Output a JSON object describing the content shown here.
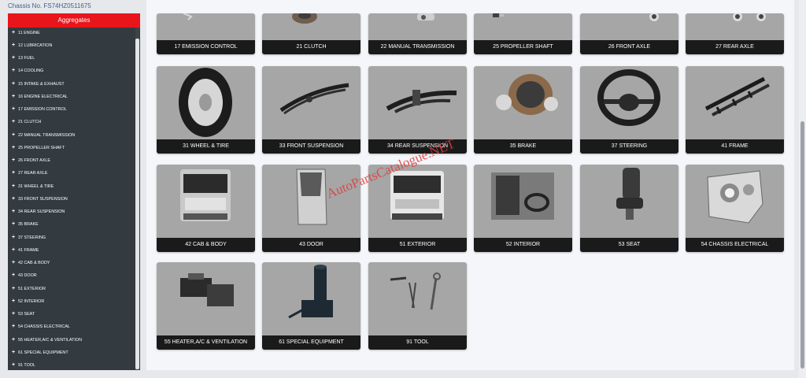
{
  "chassis": "Chassis No.  FS74HZ0511675",
  "sidebar": {
    "title": "Aggregates",
    "items": [
      {
        "label": "11 ENGINE"
      },
      {
        "label": "12 LUBRICATION"
      },
      {
        "label": "13 FUEL"
      },
      {
        "label": "14 COOLING"
      },
      {
        "label": "15 INTAKE & EXHAUST"
      },
      {
        "label": "16 ENGINE ELECTRICAL"
      },
      {
        "label": "17 EMISSION CONTROL"
      },
      {
        "label": "21 CLUTCH"
      },
      {
        "label": "22 MANUAL TRANSMISSION"
      },
      {
        "label": "25 PROPELLER SHAFT"
      },
      {
        "label": "26 FRONT AXLE"
      },
      {
        "label": "27 REAR AXLE"
      },
      {
        "label": "31 WHEEL & TIRE"
      },
      {
        "label": "33 FRONT SUSPENSION"
      },
      {
        "label": "34 REAR SUSPENSION"
      },
      {
        "label": "35 BRAKE"
      },
      {
        "label": "37 STEERING"
      },
      {
        "label": "41 FRAME"
      },
      {
        "label": "42 CAB & BODY"
      },
      {
        "label": "43 DOOR"
      },
      {
        "label": "51 EXTERIOR"
      },
      {
        "label": "52 INTERIOR"
      },
      {
        "label": "53 SEAT"
      },
      {
        "label": "54 CHASSIS ELECTRICAL"
      },
      {
        "label": "55 HEATER,A/C & VENTILATION"
      },
      {
        "label": "61 SPECIAL EQUIPMENT"
      },
      {
        "label": "91 TOOL"
      }
    ]
  },
  "grid": {
    "tiles": [
      {
        "label": "17 EMISSION CONTROL",
        "icon": "emission-control-icon"
      },
      {
        "label": "21 CLUTCH",
        "icon": "clutch-icon"
      },
      {
        "label": "22 MANUAL TRANSMISSION",
        "icon": "transmission-icon"
      },
      {
        "label": "25 PROPELLER SHAFT",
        "icon": "propeller-shaft-icon"
      },
      {
        "label": "26 FRONT AXLE",
        "icon": "front-axle-icon"
      },
      {
        "label": "27 REAR AXLE",
        "icon": "rear-axle-icon"
      },
      {
        "label": "31 WHEEL & TIRE",
        "icon": "wheel-tire-icon"
      },
      {
        "label": "33 FRONT SUSPENSION",
        "icon": "front-suspension-icon"
      },
      {
        "label": "34 REAR SUSPENSION",
        "icon": "rear-suspension-icon"
      },
      {
        "label": "35 BRAKE",
        "icon": "brake-icon"
      },
      {
        "label": "37 STEERING",
        "icon": "steering-wheel-icon"
      },
      {
        "label": "41 FRAME",
        "icon": "frame-icon"
      },
      {
        "label": "42 CAB & BODY",
        "icon": "cab-body-icon"
      },
      {
        "label": "43 DOOR",
        "icon": "door-icon"
      },
      {
        "label": "51 EXTERIOR",
        "icon": "truck-exterior-icon"
      },
      {
        "label": "52 INTERIOR",
        "icon": "interior-icon"
      },
      {
        "label": "53 SEAT",
        "icon": "seat-icon"
      },
      {
        "label": "54 CHASSIS ELECTRICAL",
        "icon": "headlamp-icon"
      },
      {
        "label": "55 HEATER,A/C & VENTILATION",
        "icon": "heater-unit-icon"
      },
      {
        "label": "61 SPECIAL EQUIPMENT",
        "icon": "special-equipment-icon"
      },
      {
        "label": "91 TOOL",
        "icon": "tools-icon"
      }
    ]
  },
  "watermark": "AutoPartsCatalogue.NET",
  "colors": {
    "header_red": "#e8151b",
    "sidebar_bg": "#333a40",
    "tile_bg": "#a6a6a6",
    "label_bg": "#1a1a1a",
    "chassis_text": "#3e5f8a"
  }
}
